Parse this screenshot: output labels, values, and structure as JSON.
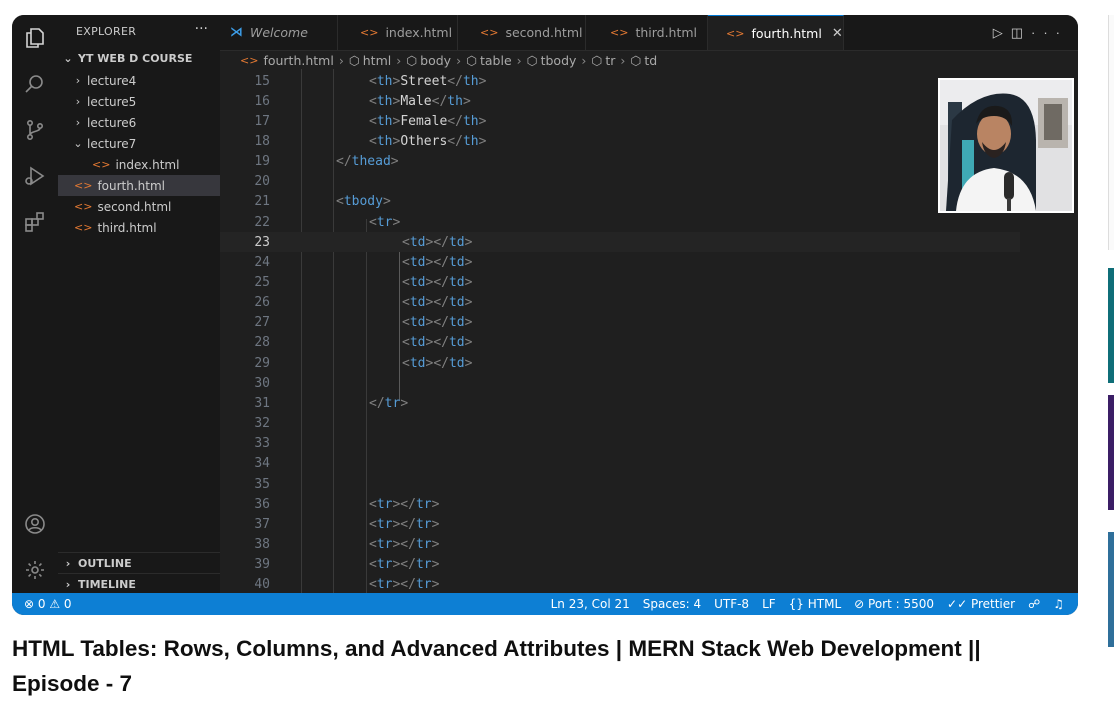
{
  "explorer": {
    "header": "EXPLORER",
    "more": "···",
    "root": "YT WEB D COURSE",
    "items": [
      {
        "label": "lecture4",
        "type": "folder",
        "expanded": false,
        "level": 1
      },
      {
        "label": "lecture5",
        "type": "folder",
        "expanded": false,
        "level": 1
      },
      {
        "label": "lecture6",
        "type": "folder",
        "expanded": false,
        "level": 1
      },
      {
        "label": "lecture7",
        "type": "folder",
        "expanded": true,
        "level": 1
      },
      {
        "label": "index.html",
        "type": "file",
        "level": 2
      },
      {
        "label": "fourth.html",
        "type": "file",
        "level": 1,
        "selected": true
      },
      {
        "label": "second.html",
        "type": "file",
        "level": 1
      },
      {
        "label": "third.html",
        "type": "file",
        "level": 1
      }
    ],
    "outline": "OUTLINE",
    "timeline": "TIMELINE"
  },
  "tabs": [
    {
      "label": "Welcome",
      "kind": "vscode"
    },
    {
      "label": "index.html",
      "kind": "html"
    },
    {
      "label": "second.html",
      "kind": "html"
    },
    {
      "label": "third.html",
      "kind": "html"
    },
    {
      "label": "fourth.html",
      "kind": "html",
      "active": true
    }
  ],
  "breadcrumb": [
    "fourth.html",
    "html",
    "body",
    "table",
    "tbody",
    "tr",
    "td"
  ],
  "editor": {
    "current_line": "23",
    "lines": [
      {
        "n": "15",
        "indent": 3,
        "parts": [
          [
            "br",
            "<"
          ],
          [
            "tag",
            "th"
          ],
          [
            "br",
            ">"
          ],
          [
            "txt",
            "Street"
          ],
          [
            "br",
            "</"
          ],
          [
            "tag",
            "th"
          ],
          [
            "br",
            ">"
          ]
        ]
      },
      {
        "n": "16",
        "indent": 3,
        "parts": [
          [
            "br",
            "<"
          ],
          [
            "tag",
            "th"
          ],
          [
            "br",
            ">"
          ],
          [
            "txt",
            "Male"
          ],
          [
            "br",
            "</"
          ],
          [
            "tag",
            "th"
          ],
          [
            "br",
            ">"
          ]
        ]
      },
      {
        "n": "17",
        "indent": 3,
        "parts": [
          [
            "br",
            "<"
          ],
          [
            "tag",
            "th"
          ],
          [
            "br",
            ">"
          ],
          [
            "txt",
            "Female"
          ],
          [
            "br",
            "</"
          ],
          [
            "tag",
            "th"
          ],
          [
            "br",
            ">"
          ]
        ]
      },
      {
        "n": "18",
        "indent": 3,
        "parts": [
          [
            "br",
            "<"
          ],
          [
            "tag",
            "th"
          ],
          [
            "br",
            ">"
          ],
          [
            "txt",
            "Others"
          ],
          [
            "br",
            "</"
          ],
          [
            "tag",
            "th"
          ],
          [
            "br",
            ">"
          ]
        ]
      },
      {
        "n": "19",
        "indent": 2,
        "parts": [
          [
            "br",
            "</"
          ],
          [
            "tag",
            "thead"
          ],
          [
            "br",
            ">"
          ]
        ]
      },
      {
        "n": "20",
        "indent": 0,
        "parts": []
      },
      {
        "n": "21",
        "indent": 2,
        "parts": [
          [
            "br",
            "<"
          ],
          [
            "tag",
            "tbody"
          ],
          [
            "br",
            ">"
          ]
        ]
      },
      {
        "n": "22",
        "indent": 3,
        "parts": [
          [
            "br",
            "<"
          ],
          [
            "tag",
            "tr"
          ],
          [
            "br",
            ">"
          ]
        ]
      },
      {
        "n": "23",
        "indent": 4,
        "parts": [
          [
            "br",
            "<"
          ],
          [
            "tag",
            "td"
          ],
          [
            "br",
            ">"
          ],
          [
            "br",
            "</"
          ],
          [
            "tag",
            "td"
          ],
          [
            "br",
            ">"
          ]
        ]
      },
      {
        "n": "24",
        "indent": 4,
        "parts": [
          [
            "br",
            "<"
          ],
          [
            "tag",
            "td"
          ],
          [
            "br",
            ">"
          ],
          [
            "br",
            "</"
          ],
          [
            "tag",
            "td"
          ],
          [
            "br",
            ">"
          ]
        ]
      },
      {
        "n": "25",
        "indent": 4,
        "parts": [
          [
            "br",
            "<"
          ],
          [
            "tag",
            "td"
          ],
          [
            "br",
            ">"
          ],
          [
            "br",
            "</"
          ],
          [
            "tag",
            "td"
          ],
          [
            "br",
            ">"
          ]
        ]
      },
      {
        "n": "26",
        "indent": 4,
        "parts": [
          [
            "br",
            "<"
          ],
          [
            "tag",
            "td"
          ],
          [
            "br",
            ">"
          ],
          [
            "br",
            "</"
          ],
          [
            "tag",
            "td"
          ],
          [
            "br",
            ">"
          ]
        ]
      },
      {
        "n": "27",
        "indent": 4,
        "parts": [
          [
            "br",
            "<"
          ],
          [
            "tag",
            "td"
          ],
          [
            "br",
            ">"
          ],
          [
            "br",
            "</"
          ],
          [
            "tag",
            "td"
          ],
          [
            "br",
            ">"
          ]
        ]
      },
      {
        "n": "28",
        "indent": 4,
        "parts": [
          [
            "br",
            "<"
          ],
          [
            "tag",
            "td"
          ],
          [
            "br",
            ">"
          ],
          [
            "br",
            "</"
          ],
          [
            "tag",
            "td"
          ],
          [
            "br",
            ">"
          ]
        ]
      },
      {
        "n": "29",
        "indent": 4,
        "parts": [
          [
            "br",
            "<"
          ],
          [
            "tag",
            "td"
          ],
          [
            "br",
            ">"
          ],
          [
            "br",
            "</"
          ],
          [
            "tag",
            "td"
          ],
          [
            "br",
            ">"
          ]
        ]
      },
      {
        "n": "30",
        "indent": 0,
        "parts": []
      },
      {
        "n": "31",
        "indent": 3,
        "parts": [
          [
            "br",
            "</"
          ],
          [
            "tag",
            "tr"
          ],
          [
            "br",
            ">"
          ]
        ]
      },
      {
        "n": "32",
        "indent": 0,
        "parts": []
      },
      {
        "n": "33",
        "indent": 0,
        "parts": []
      },
      {
        "n": "34",
        "indent": 0,
        "parts": []
      },
      {
        "n": "35",
        "indent": 0,
        "parts": []
      },
      {
        "n": "36",
        "indent": 3,
        "parts": [
          [
            "br",
            "<"
          ],
          [
            "tag",
            "tr"
          ],
          [
            "br",
            "></"
          ],
          [
            "tag",
            "tr"
          ],
          [
            "br",
            ">"
          ]
        ]
      },
      {
        "n": "37",
        "indent": 3,
        "parts": [
          [
            "br",
            "<"
          ],
          [
            "tag",
            "tr"
          ],
          [
            "br",
            "></"
          ],
          [
            "tag",
            "tr"
          ],
          [
            "br",
            ">"
          ]
        ]
      },
      {
        "n": "38",
        "indent": 3,
        "parts": [
          [
            "br",
            "<"
          ],
          [
            "tag",
            "tr"
          ],
          [
            "br",
            "></"
          ],
          [
            "tag",
            "tr"
          ],
          [
            "br",
            ">"
          ]
        ]
      },
      {
        "n": "39",
        "indent": 3,
        "parts": [
          [
            "br",
            "<"
          ],
          [
            "tag",
            "tr"
          ],
          [
            "br",
            "></"
          ],
          [
            "tag",
            "tr"
          ],
          [
            "br",
            ">"
          ]
        ]
      },
      {
        "n": "40",
        "indent": 3,
        "parts": [
          [
            "br",
            "<"
          ],
          [
            "tag",
            "tr"
          ],
          [
            "br",
            "></"
          ],
          [
            "tag",
            "tr"
          ],
          [
            "br",
            ">"
          ]
        ]
      }
    ]
  },
  "statusbar": {
    "problems": "⊗ 0 ⚠ 0",
    "position": "Ln 23, Col 21",
    "spaces": "Spaces: 4",
    "encoding": "UTF-8",
    "eol": "LF",
    "language": "{} HTML",
    "port": "⊘ Port : 5500",
    "prettier": "✓✓ Prettier"
  },
  "video_title": "HTML Tables: Rows, Columns, and Advanced Attributes | MERN Stack Web Development || Episode - 7",
  "colors": {
    "accent": "#0d7fd4",
    "tag": "#569cd6",
    "html_icon": "#e37933"
  }
}
